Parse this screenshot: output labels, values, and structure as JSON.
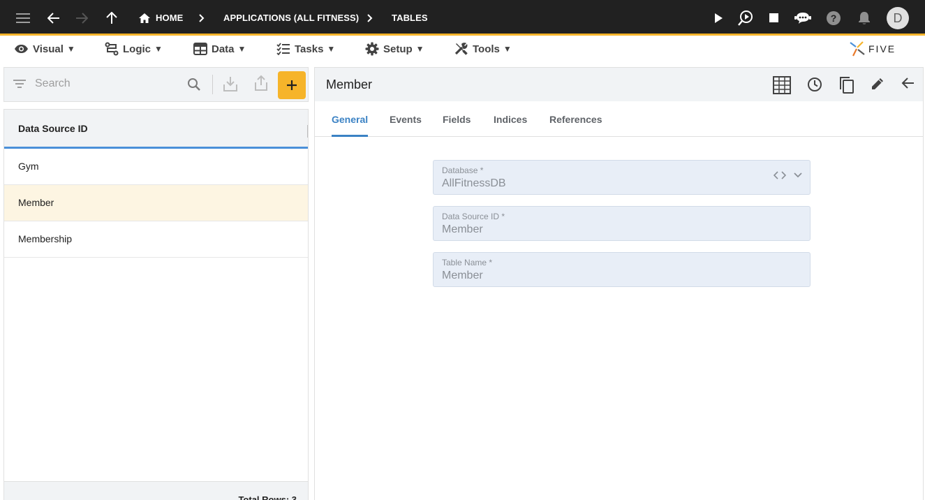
{
  "breadcrumb": {
    "home": "HOME",
    "app": "APPLICATIONS (ALL FITNESS)",
    "page": "TABLES"
  },
  "user": {
    "avatar_initial": "D"
  },
  "menu": {
    "items": [
      {
        "label": "Visual",
        "icon": "eye-icon"
      },
      {
        "label": "Logic",
        "icon": "logic-icon"
      },
      {
        "label": "Data",
        "icon": "table-icon"
      },
      {
        "label": "Tasks",
        "icon": "tasks-icon"
      },
      {
        "label": "Setup",
        "icon": "gear-icon"
      },
      {
        "label": "Tools",
        "icon": "tools-icon"
      }
    ],
    "caret": "▼"
  },
  "logo": {
    "text": "FIVE"
  },
  "search": {
    "placeholder": "Search"
  },
  "list": {
    "header": "Data Source ID",
    "rows": [
      "Gym",
      "Member",
      "Membership"
    ],
    "selected": "Member",
    "footer": "Total Rows: 3"
  },
  "detail": {
    "title": "Member",
    "tabs": [
      "General",
      "Events",
      "Fields",
      "Indices",
      "References"
    ],
    "active_tab": "General",
    "fields": [
      {
        "label": "Database *",
        "value": "AllFitnessDB"
      },
      {
        "label": "Data Source ID *",
        "value": "Member"
      },
      {
        "label": "Table Name *",
        "value": "Member"
      }
    ]
  },
  "colors": {
    "topbar": "#212121",
    "accent": "#f6b42a",
    "active_tab": "#3b82c4",
    "selected_row": "#fdf5e2"
  }
}
